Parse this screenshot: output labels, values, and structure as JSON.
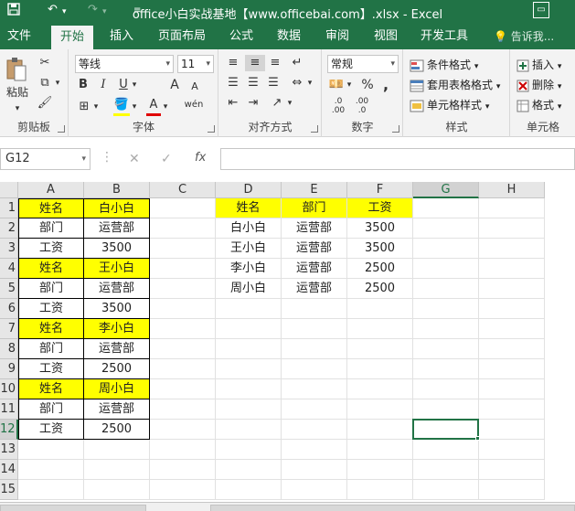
{
  "title_bar": {
    "title": "office小白实战基地【www.officebai.com】.xlsx - Excel",
    "save_icon": "save-icon",
    "undo_icon": "undo-icon",
    "redo_icon": "redo-icon",
    "customize_icon": "customize-quick-access-icon",
    "restore_icon": "ribbon-display-options-icon"
  },
  "ribbon_tabs": [
    {
      "label": "文件"
    },
    {
      "label": "开始"
    },
    {
      "label": "插入"
    },
    {
      "label": "页面布局"
    },
    {
      "label": "公式"
    },
    {
      "label": "数据"
    },
    {
      "label": "审阅"
    },
    {
      "label": "视图"
    },
    {
      "label": "开发工具"
    }
  ],
  "active_tab": "开始",
  "tell_me": "告诉我...",
  "ribbon": {
    "clipboard": {
      "label": "剪贴板",
      "paste": "粘贴"
    },
    "font": {
      "label": "字体",
      "name": "等线",
      "size": "11",
      "bold": "B",
      "italic": "I",
      "underline": "U",
      "grow": "A",
      "shrink": "A",
      "font_color": "A",
      "phonetic": "wén"
    },
    "alignment": {
      "label": "对齐方式"
    },
    "number": {
      "label": "数字",
      "format": "常规",
      "percent": "%",
      "comma": ","
    },
    "styles": {
      "label": "样式",
      "conditional": "条件格式",
      "table": "套用表格格式",
      "cell_styles": "单元格样式"
    },
    "cells": {
      "label": "单元格",
      "insert": "插入",
      "delete": "删除",
      "format": "格式"
    }
  },
  "formula_bar": {
    "name_box": "G12",
    "cancel": "✕",
    "enter": "✓",
    "fx": "fx",
    "value": ""
  },
  "columns": [
    "A",
    "B",
    "C",
    "D",
    "E",
    "F",
    "G",
    "H"
  ],
  "rows": [
    "1",
    "2",
    "3",
    "4",
    "5",
    "6",
    "7",
    "8",
    "9",
    "10",
    "11",
    "12",
    "13",
    "14",
    "15"
  ],
  "selected_cell": {
    "col": "G",
    "row": "12"
  },
  "cells": {
    "A1": "姓名",
    "B1": "白小白",
    "A2": "部门",
    "B2": "运营部",
    "A3": "工资",
    "B3": "3500",
    "A4": "姓名",
    "B4": "王小白",
    "A5": "部门",
    "B5": "运营部",
    "A6": "工资",
    "B6": "3500",
    "A7": "姓名",
    "B7": "李小白",
    "A8": "部门",
    "B8": "运营部",
    "A9": "工资",
    "B9": "2500",
    "A10": "姓名",
    "B10": "周小白",
    "A11": "部门",
    "B11": "运营部",
    "A12": "工资",
    "B12": "2500",
    "D1": "姓名",
    "E1": "部门",
    "F1": "工资",
    "D2": "白小白",
    "E2": "运营部",
    "F2": "3500",
    "D3": "王小白",
    "E3": "运营部",
    "F3": "3500",
    "D4": "李小白",
    "E4": "运营部",
    "F4": "2500",
    "D5": "周小白",
    "E5": "运营部",
    "F5": "2500"
  },
  "highlight_color": "#ffff00",
  "accent_color": "#217346"
}
